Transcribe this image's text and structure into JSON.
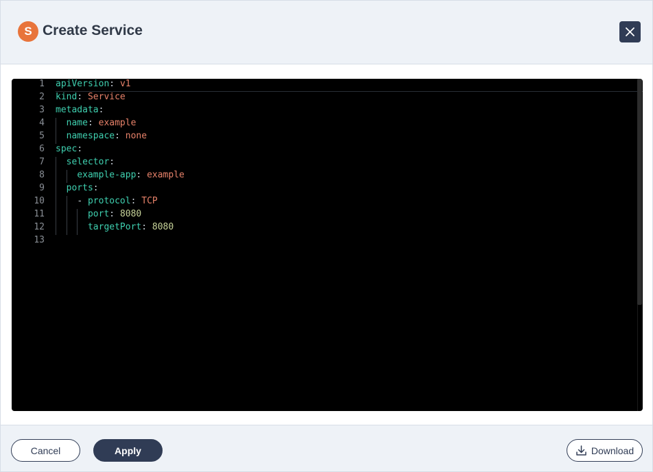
{
  "header": {
    "brand_letter": "S",
    "title": "Create Service",
    "close_icon": "close-icon"
  },
  "editor": {
    "line_numbers": [
      "1",
      "2",
      "3",
      "4",
      "5",
      "6",
      "7",
      "8",
      "9",
      "10",
      "11",
      "12",
      "13"
    ],
    "lines": [
      {
        "indent": 0,
        "tokens": [
          {
            "t": "apiVersion",
            "c": "k"
          },
          {
            "t": ": ",
            "c": "p"
          },
          {
            "t": "v1",
            "c": "s"
          }
        ]
      },
      {
        "indent": 0,
        "tokens": [
          {
            "t": "kind",
            "c": "k"
          },
          {
            "t": ": ",
            "c": "p"
          },
          {
            "t": "Service",
            "c": "s"
          }
        ]
      },
      {
        "indent": 0,
        "tokens": [
          {
            "t": "metadata",
            "c": "k"
          },
          {
            "t": ":",
            "c": "p"
          }
        ]
      },
      {
        "indent": 1,
        "tokens": [
          {
            "t": "name",
            "c": "k"
          },
          {
            "t": ": ",
            "c": "p"
          },
          {
            "t": "example",
            "c": "s"
          }
        ]
      },
      {
        "indent": 1,
        "tokens": [
          {
            "t": "namespace",
            "c": "k"
          },
          {
            "t": ": ",
            "c": "p"
          },
          {
            "t": "none",
            "c": "s"
          }
        ]
      },
      {
        "indent": 0,
        "tokens": [
          {
            "t": "spec",
            "c": "k"
          },
          {
            "t": ":",
            "c": "p"
          }
        ]
      },
      {
        "indent": 1,
        "tokens": [
          {
            "t": "selector",
            "c": "k"
          },
          {
            "t": ":",
            "c": "p"
          }
        ]
      },
      {
        "indent": 2,
        "tokens": [
          {
            "t": "example-app",
            "c": "k"
          },
          {
            "t": ": ",
            "c": "p"
          },
          {
            "t": "example",
            "c": "s"
          }
        ]
      },
      {
        "indent": 1,
        "tokens": [
          {
            "t": "ports",
            "c": "k"
          },
          {
            "t": ":",
            "c": "p"
          }
        ]
      },
      {
        "indent": 2,
        "tokens": [
          {
            "t": "- ",
            "c": "p"
          },
          {
            "t": "protocol",
            "c": "k"
          },
          {
            "t": ": ",
            "c": "p"
          },
          {
            "t": "TCP",
            "c": "s"
          }
        ]
      },
      {
        "indent": 3,
        "tokens": [
          {
            "t": "port",
            "c": "k"
          },
          {
            "t": ": ",
            "c": "p"
          },
          {
            "t": "8080",
            "c": "n"
          }
        ]
      },
      {
        "indent": 3,
        "tokens": [
          {
            "t": "targetPort",
            "c": "k"
          },
          {
            "t": ": ",
            "c": "p"
          },
          {
            "t": "8080",
            "c": "n"
          }
        ]
      },
      {
        "indent": 0,
        "tokens": []
      }
    ]
  },
  "footer": {
    "cancel_label": "Cancel",
    "apply_label": "Apply",
    "download_label": "Download",
    "download_icon": "download-icon"
  },
  "colors": {
    "accent": "#303c55",
    "brand": "#e8743b",
    "key": "#3fd0b0",
    "string": "#e8826a",
    "number": "#c8d49a"
  }
}
